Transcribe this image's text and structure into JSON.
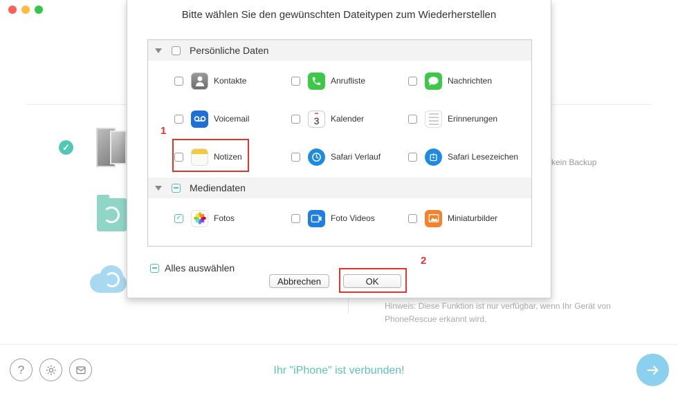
{
  "background": {
    "no_backup_text": "kein Backup",
    "hint_text": "Hinweis: Diese Funktion ist nur verfügbar, wenn Ihr Gerät von PhoneRescue erkannt wird.",
    "status_text": "Ihr \"iPhone\" ist verbunden!",
    "icons": [
      "question-icon",
      "gear-icon",
      "mail-icon",
      "arrow-right-icon"
    ]
  },
  "dialog": {
    "title": "Bitte wählen Sie den gewünschten Dateitypen zum Wiederherstellen",
    "sections": [
      {
        "label": "Persönliche Daten",
        "state": "unchecked",
        "items": [
          {
            "label": "Kontakte",
            "icon": "contacts-icon",
            "checked": false
          },
          {
            "label": "Anrufliste",
            "icon": "phone-icon",
            "checked": false
          },
          {
            "label": "Nachrichten",
            "icon": "messages-icon",
            "checked": false
          },
          {
            "label": "Voicemail",
            "icon": "voicemail-icon",
            "checked": false
          },
          {
            "label": "Kalender",
            "icon": "calendar-icon",
            "checked": false
          },
          {
            "label": "Erinnerungen",
            "icon": "reminders-icon",
            "checked": false
          },
          {
            "label": "Notizen",
            "icon": "notes-icon",
            "checked": false
          },
          {
            "label": "Safari Verlauf",
            "icon": "safari-history-icon",
            "checked": false
          },
          {
            "label": "Safari Lesezeichen",
            "icon": "safari-bookmarks-icon",
            "checked": false
          }
        ]
      },
      {
        "label": "Mediendaten",
        "state": "partial",
        "items": [
          {
            "label": "Fotos",
            "icon": "photos-icon",
            "checked": true
          },
          {
            "label": "Foto Videos",
            "icon": "photo-videos-icon",
            "checked": false
          },
          {
            "label": "Miniaturbilder",
            "icon": "thumbnails-icon",
            "checked": false
          }
        ]
      }
    ],
    "calendar_icon_day": "3",
    "select_all_label": "Alles auswählen",
    "cancel_label": "Abbrechen",
    "ok_label": "OK",
    "annotations": [
      {
        "number": "1",
        "target": "Notizen"
      },
      {
        "number": "2",
        "target": "OK"
      }
    ],
    "colors": {
      "accent": "#4fbfb0",
      "highlight": "#e5322c",
      "status": "#5cc4b6"
    }
  }
}
